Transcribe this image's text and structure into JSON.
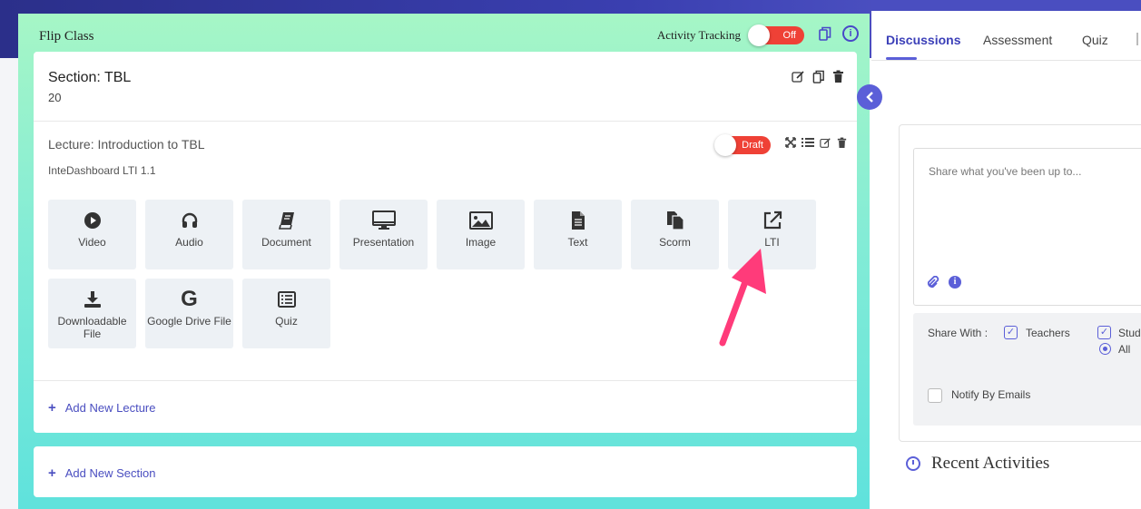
{
  "main": {
    "title": "Flip Class",
    "activity_tracking_label": "Activity Tracking",
    "activity_tracking_state": "Off"
  },
  "section": {
    "title": "Section: TBL",
    "count": "20"
  },
  "lecture": {
    "title": "Lecture: Introduction to TBL",
    "subtitle": "InteDashboard LTI 1.1",
    "status": "Draft"
  },
  "tiles": [
    {
      "label": "Video",
      "icon": "play-circle-icon"
    },
    {
      "label": "Audio",
      "icon": "headphones-icon"
    },
    {
      "label": "Document",
      "icon": "book-icon"
    },
    {
      "label": "Presentation",
      "icon": "monitor-icon"
    },
    {
      "label": "Image",
      "icon": "image-icon"
    },
    {
      "label": "Text",
      "icon": "file-text-icon"
    },
    {
      "label": "Scorm",
      "icon": "files-icon"
    },
    {
      "label": "LTI",
      "icon": "external-link-icon"
    },
    {
      "label": "Downloadable File",
      "icon": "download-icon"
    },
    {
      "label": "Google Drive File",
      "icon": "google-icon"
    },
    {
      "label": "Quiz",
      "icon": "list-icon"
    }
  ],
  "actions": {
    "add_lecture": "Add New Lecture",
    "add_section": "Add New Section"
  },
  "right_panel": {
    "tabs": [
      "Discussions",
      "Assessment",
      "Quiz"
    ],
    "active_tab": "Discussions",
    "post_placeholder": "Share what you've been up to...",
    "share_with_label": "Share With :",
    "opt_teachers": "Teachers",
    "opt_students_cut": "Stud",
    "opt_all_cut": "All",
    "notify_label": "Notify By Emails",
    "recent_title": "Recent Activities"
  },
  "colors": {
    "accent": "#5b5fd8",
    "toggle_red": "#ef4136",
    "arrow_pink": "#ff3b7a"
  }
}
